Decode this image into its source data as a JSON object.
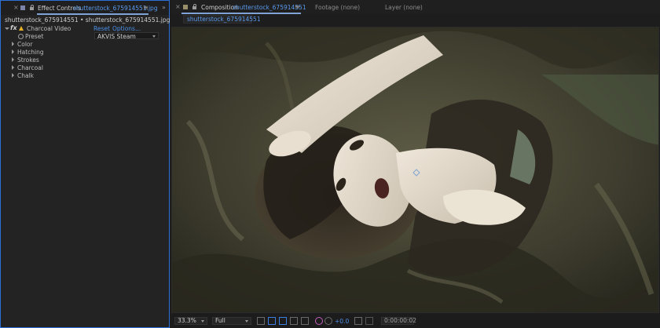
{
  "left_panel": {
    "tab": {
      "close": "×",
      "label": "Effect Controls",
      "file": "shutterstock_675914551.jpg",
      "menu": "≡",
      "expand": "»"
    },
    "path": "shutterstock_675914551 • shutterstock_675914551.jpg",
    "effect": {
      "fx": "fx",
      "name": "Charcoal Video",
      "reset": "Reset",
      "options": "Options..."
    },
    "preset": {
      "label": "Preset",
      "value": "AKVIS Steam"
    },
    "groups": [
      "Color",
      "Hatching",
      "Strokes",
      "Charcoal",
      "Chalk"
    ]
  },
  "right_panel": {
    "tabs": {
      "close": "×",
      "composition_label": "Composition",
      "composition_name": "shutterstock_675914551",
      "menu": "≡",
      "footage": "Footage  (none)",
      "layer": "Layer  (none)"
    },
    "subtab": "shutterstock_675914551",
    "bottom_bar": {
      "zoom": "33.3%",
      "resolution": "Full",
      "exposure": "+0.0",
      "timecode": "0:00:00:02"
    }
  },
  "colors": {
    "accent": "#2c6fd6",
    "link": "#4b8fe8",
    "warning": "#e5b22a"
  }
}
